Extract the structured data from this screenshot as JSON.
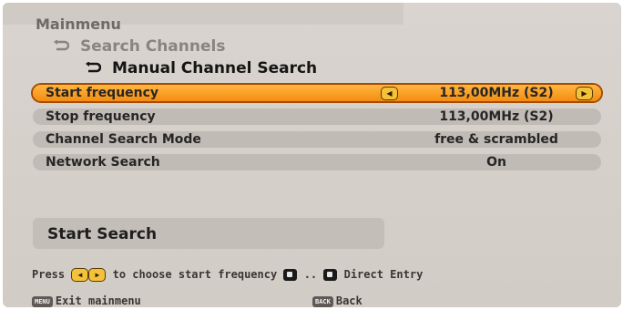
{
  "breadcrumb": {
    "main": "Mainmenu",
    "sub": "Search Channels",
    "page": "Manual Channel Search",
    "arrow_icon": "curved-arrow-icon"
  },
  "rows": [
    {
      "label": "Start frequency",
      "value": "113,00MHz (S2)",
      "selected": true
    },
    {
      "label": "Stop frequency",
      "value": "113,00MHz (S2)",
      "selected": false
    },
    {
      "label": "Channel Search Mode",
      "value": "free & scrambled",
      "selected": false
    },
    {
      "label": "Network Search",
      "value": "On",
      "selected": false
    }
  ],
  "start_search": {
    "label": "Start Search"
  },
  "help": {
    "press": "Press",
    "choose_text": "to choose start frequency",
    "range_sep": "..",
    "direct_entry": "Direct Entry",
    "left_icon": "left-arrow-key-icon",
    "right_icon": "right-arrow-key-icon",
    "digit_icon": "digit-key-icon"
  },
  "footer": {
    "menu_key": "MENU",
    "menu_text": "Exit mainmenu",
    "back_key": "BACK",
    "back_text": "Back"
  },
  "colors": {
    "panel_bg": "#d2ccc6",
    "row_bg": "#c1bbb6",
    "selected_bg": "#f48c10",
    "selected_border": "#a64a00",
    "key_yellow": "#f4c23a"
  }
}
